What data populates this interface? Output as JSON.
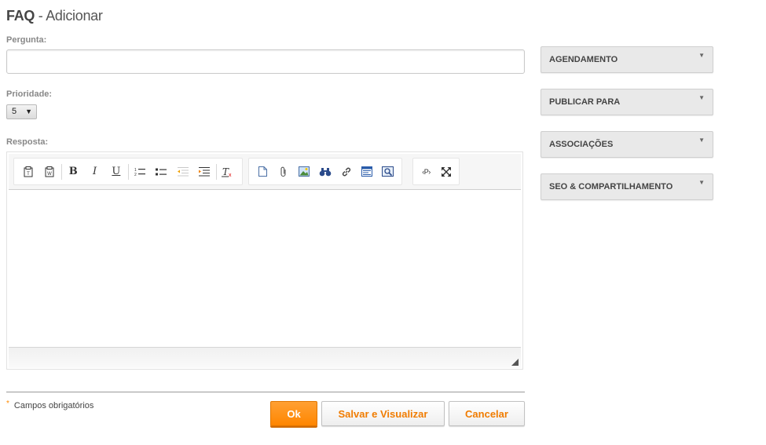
{
  "header": {
    "title_bold": "FAQ",
    "title_rest": " - Adicionar"
  },
  "form": {
    "pergunta": {
      "label": "Pergunta:",
      "value": "",
      "placeholder": ""
    },
    "prioridade": {
      "label": "Prioridade:",
      "value": "5",
      "arrow": "▼"
    },
    "resposta": {
      "label": "Resposta:"
    }
  },
  "toolbar": {
    "paste_text": "paste-text-icon",
    "paste_word": "paste-word-icon",
    "bold": "B",
    "italic": "I",
    "underline": "U",
    "remove_format": "Tx",
    "source": "‹P›",
    "maximize": "⤢"
  },
  "sidebar": {
    "panels": [
      {
        "label": "AGENDAMENTO"
      },
      {
        "label": "PUBLICAR PARA"
      },
      {
        "label": "ASSOCIAÇÕES"
      },
      {
        "label": "SEO & COMPARTILHAMENTO"
      }
    ],
    "chevron": "▼"
  },
  "footer": {
    "required_marker": "*",
    "required_text": "Campos obrigatórios",
    "ok": "Ok",
    "save_view": "Salvar e Visualizar",
    "cancel": "Cancelar"
  },
  "colors": {
    "accent": "#ff8600",
    "accent_text": "#f07c00",
    "panel_bg": "#e9e9e9"
  }
}
